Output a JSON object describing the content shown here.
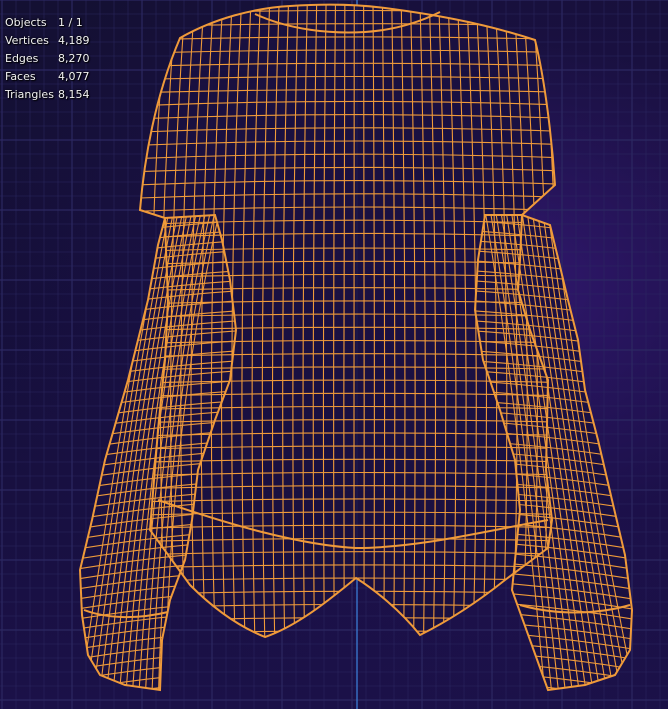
{
  "viewport": {
    "background": "#150f3a",
    "grid_color": "#2d2a63",
    "axis_color": "#3c7fd8",
    "wire_color": "#ef9a3a",
    "object_fill": "#1a1040"
  },
  "stats": {
    "objects": {
      "label": "Objects",
      "value": "1 / 1"
    },
    "vertices": {
      "label": "Vertices",
      "value": "4,189"
    },
    "edges": {
      "label": "Edges",
      "value": "8,270"
    },
    "faces": {
      "label": "Faces",
      "value": "4,077"
    },
    "triangles": {
      "label": "Triangles",
      "value": "8,154"
    }
  }
}
